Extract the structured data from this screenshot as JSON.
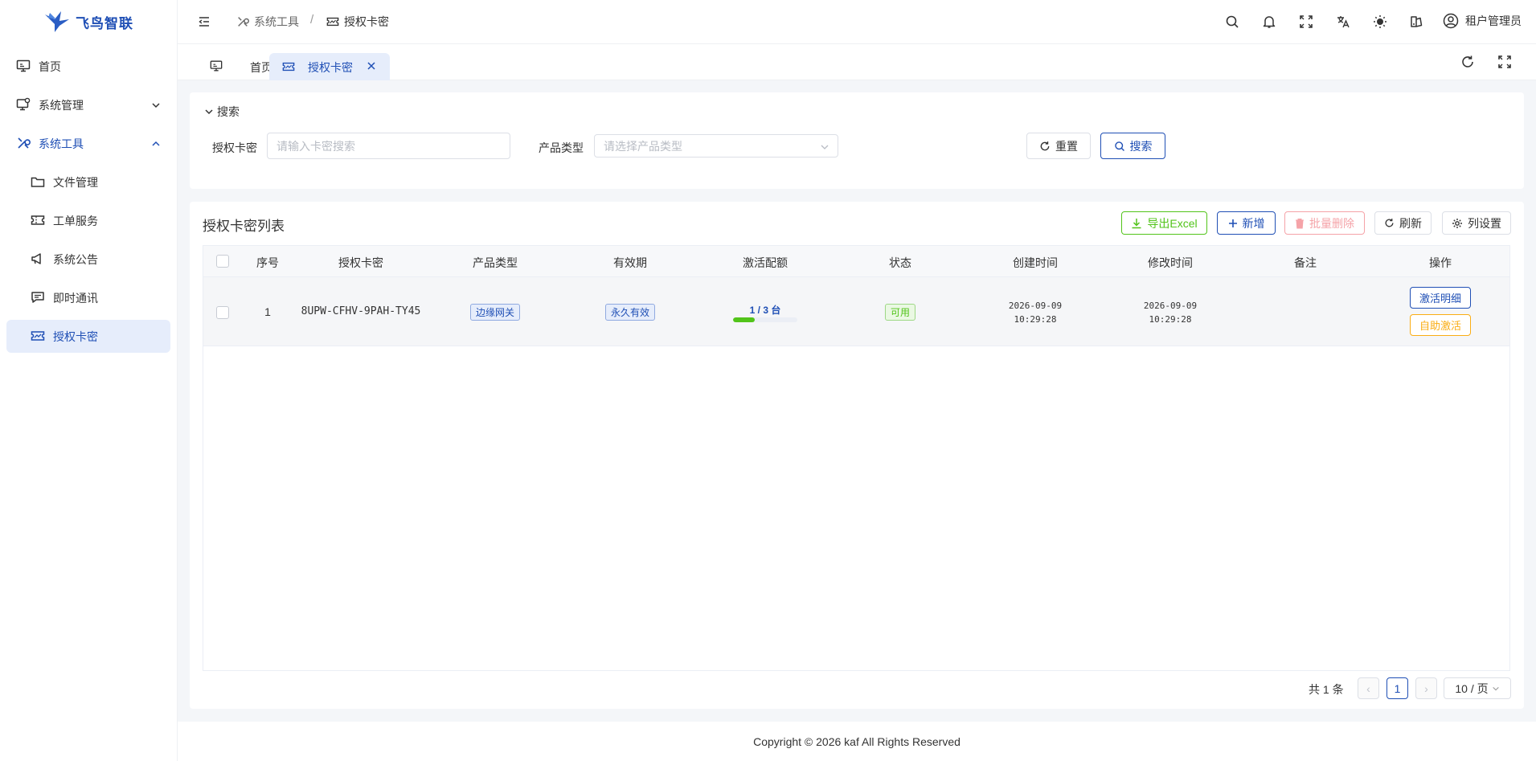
{
  "app": {
    "name": "飞鸟智联"
  },
  "sidebar": {
    "items": [
      {
        "label": "首页",
        "icon": "monitor-icon"
      },
      {
        "label": "系统管理",
        "icon": "system-settings-icon"
      },
      {
        "label": "系统工具",
        "icon": "tools-icon"
      },
      {
        "label": "文件管理",
        "icon": "folder-icon"
      },
      {
        "label": "工单服务",
        "icon": "ticket-icon"
      },
      {
        "label": "系统公告",
        "icon": "megaphone-icon"
      },
      {
        "label": "即时通讯",
        "icon": "chat-icon"
      },
      {
        "label": "授权卡密",
        "icon": "license-card-icon"
      }
    ]
  },
  "header": {
    "breadcrumb": [
      "系统工具",
      "授权卡密"
    ],
    "separator": "/",
    "user": "租户管理员"
  },
  "tabs": [
    {
      "label": "首页"
    },
    {
      "label": "授权卡密",
      "close": "×"
    }
  ],
  "search": {
    "toggle_label": "搜索",
    "card_label": "授权卡密",
    "card_placeholder": "请输入卡密搜索",
    "product_label": "产品类型",
    "product_placeholder": "请选择产品类型",
    "reset_label": "重置",
    "search_label": "搜索"
  },
  "table_card": {
    "title": "授权卡密列表",
    "export_label": "导出Excel",
    "add_label": "新增",
    "batch_delete_label": "批量删除",
    "refresh_label": "刷新",
    "columns_label": "列设置"
  },
  "table": {
    "columns": [
      "序号",
      "授权卡密",
      "产品类型",
      "有效期",
      "激活配额",
      "状态",
      "创建时间",
      "修改时间",
      "备注",
      "操作"
    ],
    "rows": [
      {
        "index": "1",
        "card": "8UPW-CFHV-9PAH-TY45",
        "product": "边缘网关",
        "validity": "永久有效",
        "quota_text": "1 / 3 台",
        "quota_fraction": 0.333,
        "status": "可用",
        "created_date": "2026-09-09",
        "created_time": "10:29:28",
        "modified_date": "2026-09-09",
        "modified_time": "10:29:28",
        "remark": "",
        "action_detail": "激活明细",
        "action_self": "自助激活"
      }
    ]
  },
  "pagination": {
    "total": "共 1 条",
    "prev": "‹",
    "current": "1",
    "next": "›",
    "page_size": "10 / 页"
  },
  "footer": {
    "copyright": "Copyright © 2026 kaf All Rights Reserved"
  },
  "colors": {
    "brand": "#1f4fb5",
    "success": "#52c41a",
    "warning": "#faad14",
    "danger": "#f5a3a8"
  }
}
